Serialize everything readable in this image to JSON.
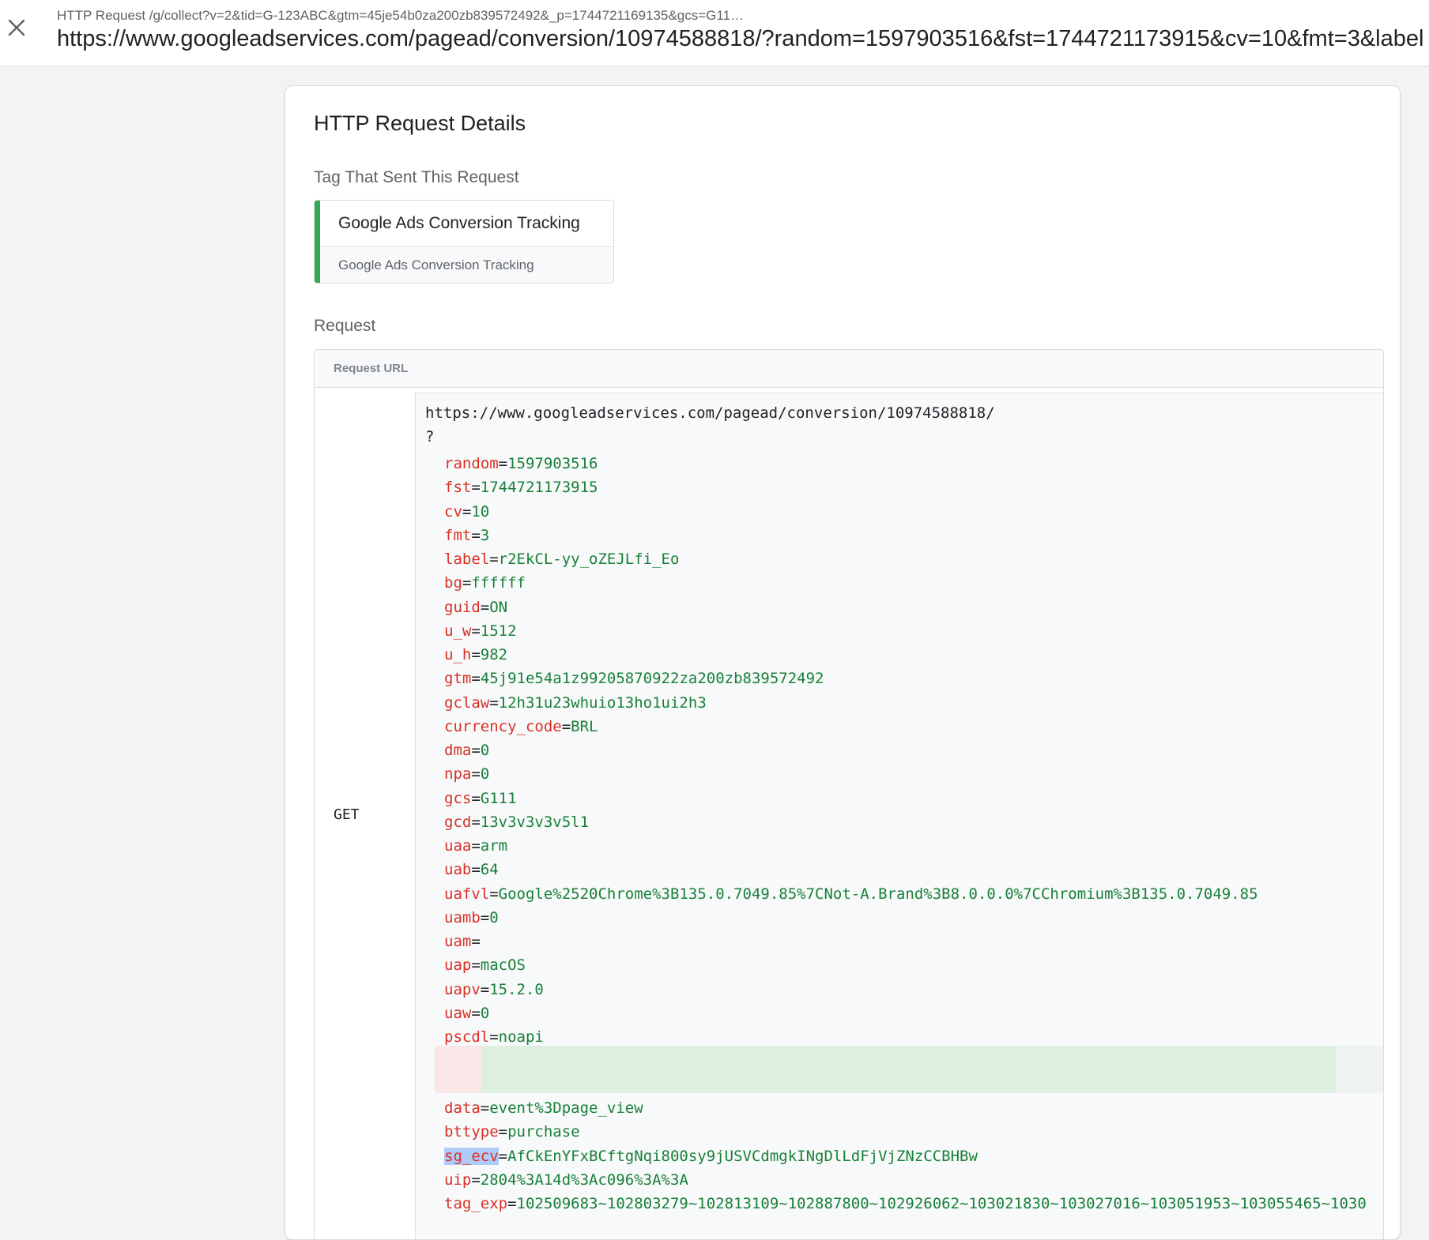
{
  "header": {
    "subtitle": "HTTP Request /g/collect?v=2&tid=G-123ABC&gtm=45je54b0za200zb839572492&_p=1744721169135&gcs=G11…",
    "title": "https://www.googleadservices.com/pagead/conversion/10974588818/?random=1597903516&fst=1744721173915&cv=10&fmt=3&label"
  },
  "panel": {
    "title": "HTTP Request Details",
    "tag_section_label": "Tag That Sent This Request",
    "tag": {
      "name": "Google Ads Conversion Tracking",
      "type": "Google Ads Conversion Tracking",
      "status_color": "#34a853"
    },
    "request_section_label": "Request",
    "request_url_label": "Request URL",
    "method": "GET",
    "url_base": "https://www.googleadservices.com/pagead/conversion/10974588818/",
    "query_mark": "?",
    "params": [
      {
        "key": "random",
        "value": "1597903516"
      },
      {
        "key": "fst",
        "value": "1744721173915"
      },
      {
        "key": "cv",
        "value": "10"
      },
      {
        "key": "fmt",
        "value": "3"
      },
      {
        "key": "label",
        "value": "r2EkCL-yy_oZEJLfi_Eo"
      },
      {
        "key": "bg",
        "value": "ffffff"
      },
      {
        "key": "guid",
        "value": "ON"
      },
      {
        "key": "u_w",
        "value": "1512"
      },
      {
        "key": "u_h",
        "value": "982"
      },
      {
        "key": "gtm",
        "value": "45j91e54a1z99205870922za200zb839572492"
      },
      {
        "key": "gclaw",
        "value": "12h31u23whuio13ho1ui2h3"
      },
      {
        "key": "currency_code",
        "value": "BRL"
      },
      {
        "key": "dma",
        "value": "0"
      },
      {
        "key": "npa",
        "value": "0"
      },
      {
        "key": "gcs",
        "value": "G111"
      },
      {
        "key": "gcd",
        "value": "13v3v3v3v5l1"
      },
      {
        "key": "uaa",
        "value": "arm"
      },
      {
        "key": "uab",
        "value": "64"
      },
      {
        "key": "uafvl",
        "value": "Google%2520Chrome%3B135.0.7049.85%7CNot-A.Brand%3B8.0.0.0%7CChromium%3B135.0.7049.85"
      },
      {
        "key": "uamb",
        "value": "0"
      },
      {
        "key": "uam",
        "value": ""
      },
      {
        "key": "uap",
        "value": "macOS"
      },
      {
        "key": "uapv",
        "value": "15.2.0"
      },
      {
        "key": "uaw",
        "value": "0"
      },
      {
        "key": "pscdl",
        "value": "noapi"
      }
    ],
    "params_after": [
      {
        "key": "data",
        "value": "event%3Dpage_view"
      },
      {
        "key": "bttype",
        "value": "purchase"
      },
      {
        "key": "sg_ecv",
        "value": "AfCkEnYFxBCftgNqi800sy9jUSVCdmgkINgDlLdFjVjZNzCCBHBw",
        "selected": true
      },
      {
        "key": "uip",
        "value": "2804%3A14d%3Ac096%3A%3A"
      },
      {
        "key": "tag_exp",
        "value": "102509683~102803279~102813109~102887800~102926062~103021830~103027016~103051953~103055465~1030"
      }
    ]
  }
}
